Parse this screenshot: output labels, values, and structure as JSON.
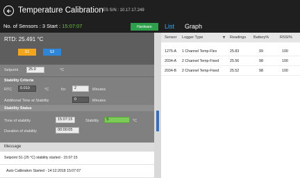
{
  "header": {
    "title": "Temperature Calibration",
    "serial": "ES S/N : 10.17.17.249",
    "sensors_label": "No. of Sensors : 3",
    "start_label": "Start :",
    "start_time": "15:07:07",
    "hardware_button": "Hardware"
  },
  "tabs": [
    {
      "label": "List",
      "active": true
    },
    {
      "label": "Graph",
      "active": false
    }
  ],
  "left_panel": {
    "rtd_label": "RTD:",
    "rtd_value": "25.491 °C",
    "s1_label": "S1",
    "s2_label": "S2",
    "setpoint_label": "Setpoint",
    "setpoint_value": "25.0",
    "setpoint_unit": "°C",
    "stability_criteria_title": "Stability Criteria",
    "rtc_label": "RTC",
    "rtc_value": "0.010",
    "rtc_unit": "°C",
    "for_label": "for",
    "minutes_value": "2",
    "minutes_label": "Minutes",
    "additional_time_label": "Additional Time at Stability",
    "additional_time_value": "0",
    "additional_time_unit": "Minutes",
    "stability_status_title": "Stability Status",
    "time_of_stability_label": "Time of stability",
    "time_of_stability_value": "15:07:15",
    "stability_label": "Stability",
    "stability_value": "S",
    "stability_unit": "°C",
    "duration_label": "Duration of stability",
    "duration_value": "00:00:05"
  },
  "messages": {
    "header": "Message",
    "items": [
      "Setpoint S1 (25 °C) stability started - 15:07:15",
      "Auto Calibration Started - 14:12:2018 15:07:07"
    ]
  },
  "table": {
    "columns": [
      "Sensor",
      "Logger Type",
      "Readings",
      "Battery%",
      "RSSI%"
    ],
    "rows": [
      [
        "1275-A",
        "1 Channel Temp-Flex",
        "25.83",
        "99",
        "100"
      ],
      [
        "2034-A",
        "2 Channel Temp-Fixed",
        "25.56",
        "98",
        "100"
      ],
      [
        "2034-B",
        "2 Channel Temp-Fixed",
        "25.52",
        "98",
        "100"
      ]
    ]
  },
  "colors": {
    "accent_blue": "#33aaff",
    "start_green": "#6cc04a",
    "s1_orange": "#f0a51c",
    "s2_blue": "#2f86d6",
    "hardware_green": "#2e9f4a"
  }
}
